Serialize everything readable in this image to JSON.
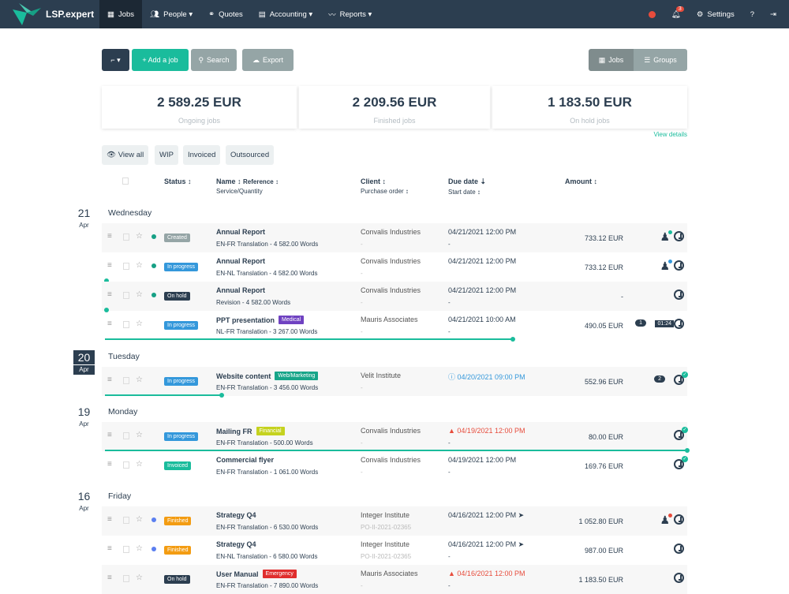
{
  "nav": {
    "brand": "LSP.expert",
    "items": [
      {
        "label": "Jobs",
        "icon": "calendar-icon"
      },
      {
        "label": "People ▾",
        "icon": "users-icon"
      },
      {
        "label": "Quotes",
        "icon": "handshake-icon"
      },
      {
        "label": "Accounting ▾",
        "icon": "invoice-icon"
      },
      {
        "label": "Reports ▾",
        "icon": "chart-line-icon"
      }
    ],
    "notifications": "3",
    "settings": "Settings"
  },
  "toolbar": {
    "add_job": "+ Add a job",
    "search": "Search",
    "export": "Export",
    "view_jobs": "Jobs",
    "view_groups": "Groups"
  },
  "summary": [
    {
      "value": "2 589.25 EUR",
      "label": "Ongoing jobs"
    },
    {
      "value": "2 209.56 EUR",
      "label": "Finished jobs"
    },
    {
      "value": "1 183.50 EUR",
      "label": "On hold jobs"
    }
  ],
  "view_details": "View details",
  "filters": [
    "View all",
    "WIP",
    "Invoiced",
    "Outsourced"
  ],
  "headers": {
    "status": "Status ↕",
    "name": "Name ↕",
    "reference": "Reference ↕",
    "service": "Service/Quantity",
    "client": "Client ↕",
    "po": "Purchase order ↕",
    "due": "Due date ⇣",
    "start": "Start date ↕",
    "amount": "Amount ↕"
  },
  "colors": {
    "teal": "#1abc9c",
    "dark": "#2c3e50",
    "blue": "#3498db",
    "orange": "#f39c12",
    "red": "#e74c3c",
    "gray": "#95a5a6",
    "purple": "#6f42c1",
    "lime": "#c5d21f",
    "green": "#17a589"
  },
  "groups": [
    {
      "num": "21",
      "month": "Apr",
      "day": "Wednesday",
      "rows": [
        {
          "status": "Created",
          "status_color": "#95a5a6",
          "dot": "#16a085",
          "name": "Annual Report",
          "service": "EN-FR Translation - 4 582.00 Words",
          "client": "Convalis Industries",
          "po": "-",
          "due": "04/21/2021 12:00 PM",
          "start": "-",
          "amount": "733.12 EUR",
          "person": "#1abc9c"
        },
        {
          "status": "In progress",
          "status_color": "#3498db",
          "dot": "#16a085",
          "name": "Annual Report",
          "service": "EN-NL Translation - 4 582.00 Words",
          "client": "Convalis Industries",
          "po": "-",
          "due": "04/21/2021 12:00 PM",
          "start": "",
          "amount": "733.12 EUR",
          "person": "#3498db",
          "progress": 0
        },
        {
          "status": "On hold",
          "status_color": "#2c3e50",
          "dot": "#16a085",
          "name": "Annual Report",
          "service": "Revision - 4 582.00 Words",
          "client": "Convalis Industries",
          "po": "-",
          "due": "04/21/2021 12:00 PM",
          "start": "-",
          "amount": "-",
          "progress": 0
        },
        {
          "status": "In progress",
          "status_color": "#3498db",
          "name": "PPT presentation",
          "tag": "Medical",
          "tag_color": "#6f42c1",
          "service": "NL-FR Translation - 3 267.00 Words",
          "client": "Mauris Associates",
          "po": "-",
          "due": "04/21/2021 10:00 AM",
          "start": "-",
          "amount": "490.05 EUR",
          "comments": "1",
          "timer": "01:24",
          "progress": 0.7
        }
      ]
    },
    {
      "num": "20",
      "month": "Apr",
      "day": "Tuesday",
      "highlight": true,
      "rows": [
        {
          "status": "In progress",
          "status_color": "#3498db",
          "name": "Website content",
          "tag": "Web/Marketing",
          "tag_color": "#17a589",
          "service": "EN-FR Translation - 3 456.00 Words",
          "client": "Velit Institute",
          "po": "-",
          "due": "04/20/2021 09:00 PM",
          "due_color": "#3498db",
          "due_icon": "ⓘ",
          "start": "",
          "amount": "552.96 EUR",
          "comments": "2",
          "check": true,
          "progress": 0.2
        }
      ]
    },
    {
      "num": "19",
      "month": "Apr",
      "day": "Monday",
      "rows": [
        {
          "status": "In progress",
          "status_color": "#3498db",
          "name": "Mailing FR",
          "tag": "Financial",
          "tag_color": "#c5d21f",
          "service": "EN-FR Translation - 500.00 Words",
          "client": "Convalis Industries",
          "po": "-",
          "due": "04/19/2021 12:00 PM",
          "due_color": "#e74c3c",
          "due_icon": "▲",
          "start": "-",
          "amount": "80.00 EUR",
          "check": true,
          "progress": 1
        },
        {
          "status": "Invoiced",
          "status_color": "#1abc9c",
          "name": "Commercial flyer",
          "service": "EN-FR Translation - 1 061.00 Words",
          "client": "Convalis Industries",
          "po": "-",
          "due": "04/19/2021 12:00 PM",
          "start": "-",
          "amount": "169.76 EUR",
          "check": true
        }
      ]
    },
    {
      "num": "16",
      "month": "Apr",
      "day": "Friday",
      "rows": [
        {
          "status": "Finished",
          "status_color": "#f39c12",
          "dot": "#5b7ff0",
          "name": "Strategy Q4",
          "service": "EN-FR Translation - 6 530.00 Words",
          "client": "Integer Institute",
          "po": "PO-II-2021-02365",
          "due": "04/16/2021 12:00 PM",
          "due_after": "➤",
          "start": "",
          "amount": "1 052.80 EUR",
          "person": "#e74c3c"
        },
        {
          "status": "Finished",
          "status_color": "#f39c12",
          "dot": "#5b7ff0",
          "name": "Strategy Q4",
          "service": "EN-NL Translation - 6 580.00 Words",
          "client": "Integer Institute",
          "po": "PO-II-2021-02365",
          "due": "04/16/2021 12:00 PM",
          "due_after": "➤",
          "start": "-",
          "amount": "987.00 EUR"
        },
        {
          "status": "On hold",
          "status_color": "#2c3e50",
          "name": "User Manual",
          "tag": "Emergency",
          "tag_color": "#e02d2d",
          "service": "EN-FR Translation - 7 890.00 Words",
          "client": "Mauris Associates",
          "po": "-",
          "due": "04/16/2021 12:00 PM",
          "due_color": "#e74c3c",
          "due_icon": "▲",
          "start": "-",
          "amount": "1 183.50 EUR"
        }
      ]
    }
  ]
}
